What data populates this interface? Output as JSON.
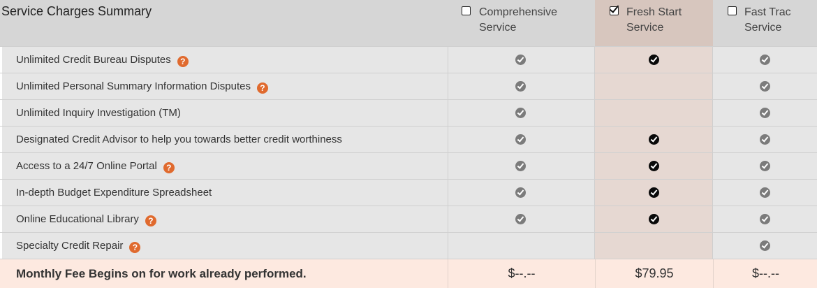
{
  "header": {
    "title": "Service Charges Summary",
    "plans": [
      {
        "line1": "Comprehensive",
        "line2": "Service",
        "checked": false
      },
      {
        "line1": "Fresh Start",
        "line2": "Service",
        "checked": true
      },
      {
        "line1": "Fast Trac",
        "line2": "Service",
        "checked": false
      }
    ]
  },
  "features": [
    {
      "label": "Unlimited Credit Bureau Disputes",
      "help": true,
      "comprehensive": true,
      "fresh_start": true,
      "fast_trac": true
    },
    {
      "label": "Unlimited Personal Summary Information Disputes",
      "help": true,
      "comprehensive": true,
      "fresh_start": false,
      "fast_trac": true
    },
    {
      "label": "Unlimited Inquiry Investigation (TM)",
      "help": false,
      "comprehensive": true,
      "fresh_start": false,
      "fast_trac": true
    },
    {
      "label": "Designated Credit Advisor to help you towards better credit worthiness",
      "help": false,
      "comprehensive": true,
      "fresh_start": true,
      "fast_trac": true
    },
    {
      "label": "Access to a 24/7 Online Portal",
      "help": true,
      "comprehensive": true,
      "fresh_start": true,
      "fast_trac": true
    },
    {
      "label": "In-depth Budget Expenditure Spreadsheet",
      "help": false,
      "comprehensive": true,
      "fresh_start": true,
      "fast_trac": true
    },
    {
      "label": "Online Educational Library",
      "help": true,
      "comprehensive": true,
      "fresh_start": true,
      "fast_trac": true
    },
    {
      "label": "Specialty Credit Repair",
      "help": true,
      "comprehensive": false,
      "fresh_start": false,
      "fast_trac": true
    }
  ],
  "help_glyph": "?",
  "footer": {
    "label": "Monthly Fee Begins on for work already performed.",
    "prices": [
      "$--.--",
      "$79.95",
      "$--.--"
    ]
  },
  "colors": {
    "help_icon": "#e06a2e",
    "selected_column": "#e6d8d2",
    "footer_background": "#fde9e0"
  }
}
